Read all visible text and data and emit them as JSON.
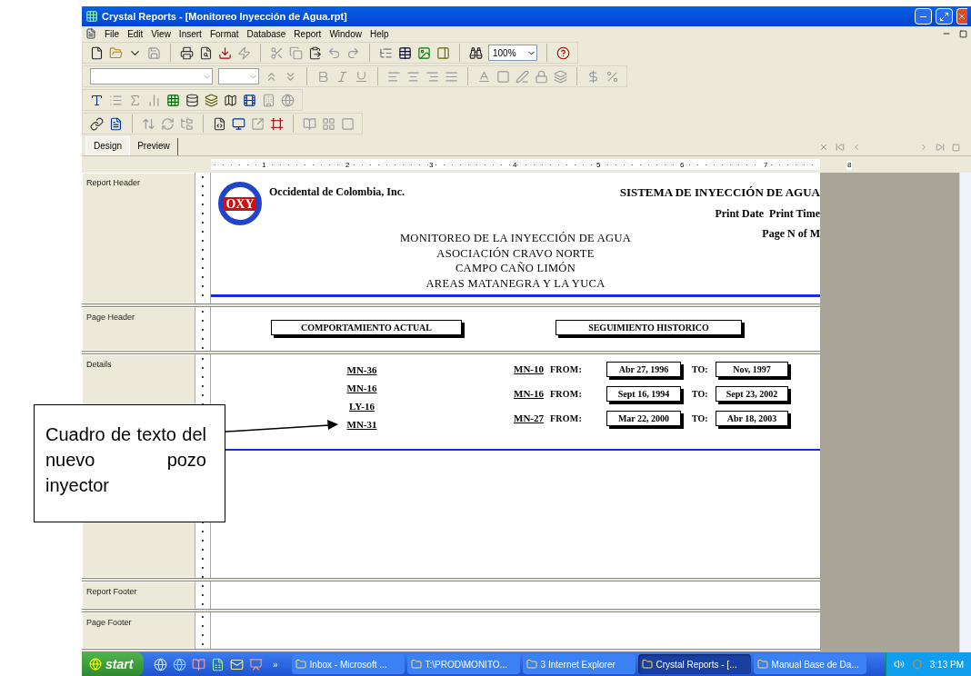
{
  "window": {
    "title": "Crystal Reports - [Monitoreo Inyección de Agua.rpt]"
  },
  "menu": [
    "File",
    "Edit",
    "View",
    "Insert",
    "Format",
    "Database",
    "Report",
    "Window",
    "Help"
  ],
  "toolbar": {
    "zoom": "100%"
  },
  "tabs": [
    {
      "label": "Design",
      "selected": true
    },
    {
      "label": "Preview",
      "selected": false
    }
  ],
  "ruler": [
    "1",
    "2",
    "3",
    "4",
    "5",
    "6",
    "7",
    "8"
  ],
  "sections": [
    {
      "name": "Report Header",
      "kind": "report_header"
    },
    {
      "name": "Page Header",
      "kind": "page_header"
    },
    {
      "name": "Details",
      "kind": "details"
    },
    {
      "name": "Report Footer",
      "kind": "empty_short"
    },
    {
      "name": "Page Footer",
      "kind": "empty_tall"
    }
  ],
  "report_header": {
    "logo": "OXY",
    "company": "Occidental de Colombia, Inc.",
    "system": "SISTEMA DE INYECCIÓN DE AGUA",
    "print_date": "Print Date",
    "print_time": "Print Time",
    "page": "Page N of M",
    "title_lines": [
      "MONITOREO DE LA INYECCIÓN DE AGUA",
      "ASOCIACIÓN CRAVO NORTE",
      "CAMPO CAÑO LIMÓN",
      "AREAS MATANEGRA Y LA YUCA"
    ]
  },
  "page_header": {
    "left": "COMPORTAMIENTO ACTUAL",
    "right": "SEGUIMIENTO HISTORICO"
  },
  "details": {
    "current_wells": [
      "MN-36",
      "MN-16",
      "LY-16",
      "MN-31"
    ],
    "history": [
      {
        "well": "MN-10",
        "from_label": "FROM:",
        "from": "Abr 27, 1996",
        "to_label": "TO:",
        "to": "Nov, 1997"
      },
      {
        "well": "MN-16",
        "from_label": "FROM:",
        "from": "Sept 16, 1994",
        "to_label": "TO:",
        "to": "Sept 23, 2002"
      },
      {
        "well": "MN-27",
        "from_label": "FROM:",
        "from": "Mar 22, 2000",
        "to_label": "TO:",
        "to": "Abr 18, 2003"
      }
    ]
  },
  "callout": {
    "text": "Cuadro de texto del nuevo pozo inyector"
  },
  "taskbar": {
    "start": "start",
    "chevron": "»",
    "tasks": [
      {
        "label": "Inbox - Microsoft ...",
        "selected": false
      },
      {
        "label": "T:\\PROD\\MONITO...",
        "selected": false
      },
      {
        "label": "3 Internet Explorer",
        "selected": false
      },
      {
        "label": "Crystal Reports - [...",
        "selected": true
      },
      {
        "label": "Manual Base de Da...",
        "selected": false
      }
    ],
    "clock": "3:13 PM"
  }
}
